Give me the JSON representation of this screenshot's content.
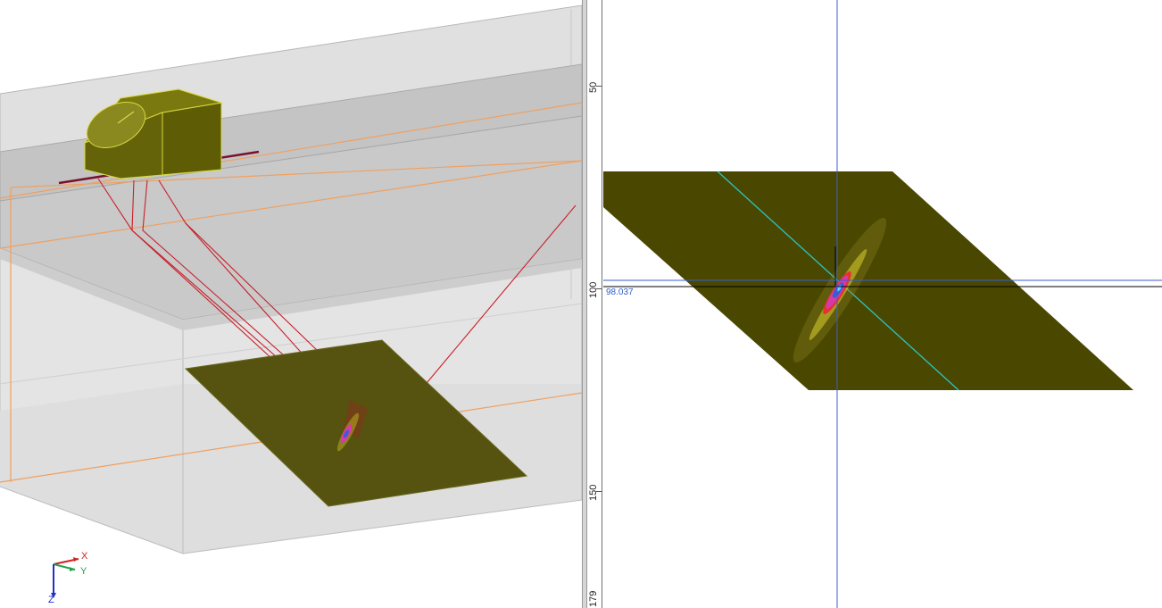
{
  "colors": {
    "surface": "#4a4800",
    "surface_3d": "#55530f",
    "ray": "#c8202a",
    "room_edge": "#f0a060",
    "crosshair": "#3b5bd6",
    "rotated_axis": "#2cc4c4"
  },
  "ruler": {
    "ticks": [
      {
        "label": "50"
      },
      {
        "label": "100"
      },
      {
        "label": "150"
      },
      {
        "label": "179"
      }
    ]
  },
  "view2d": {
    "cursor_readout": "98.037"
  },
  "axes": {
    "x_label": "X",
    "y_label": "Y",
    "z_label": "Z"
  },
  "icons": [
    "axis-triad-icon"
  ]
}
